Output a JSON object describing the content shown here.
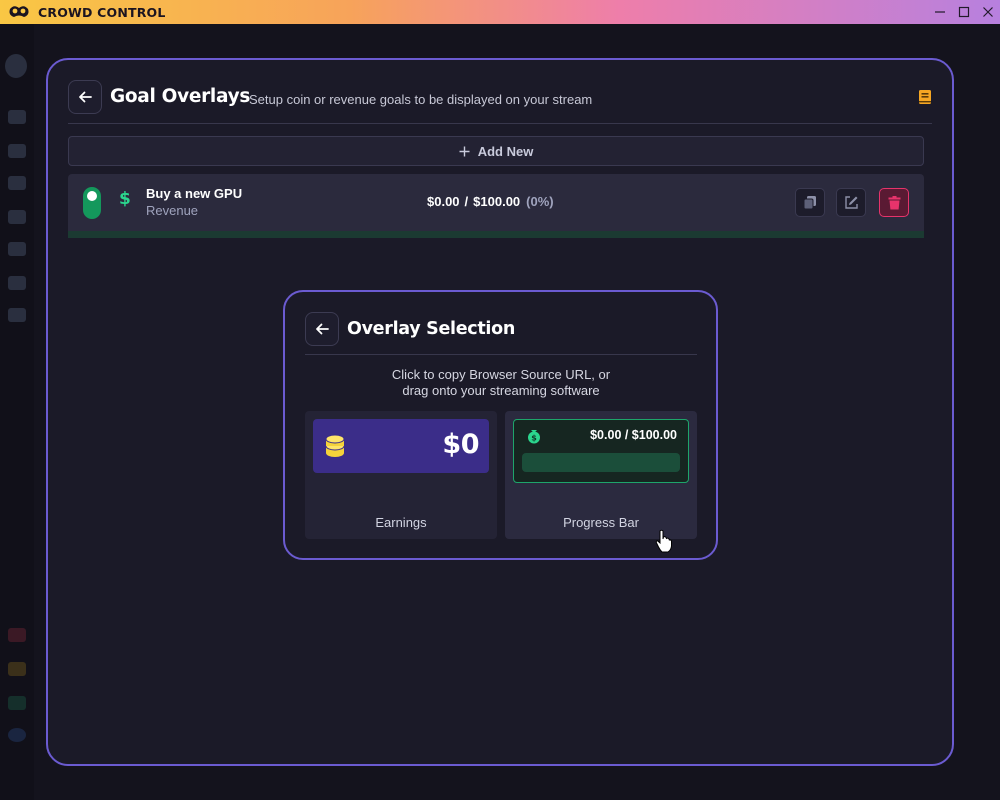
{
  "app": {
    "title": "CROWD CONTROL"
  },
  "window_controls": {
    "minimize": "—",
    "maximize": "☐",
    "close": "✕"
  },
  "page": {
    "title": "Goal Overlays",
    "subtitle": "Setup coin or revenue goals to be displayed on your stream",
    "add_new_label": "Add New"
  },
  "goals": [
    {
      "name": "Buy a new GPU",
      "type": "Revenue",
      "current": "$0.00",
      "separator": "/",
      "target": "$100.00",
      "percent": "(0%)",
      "progress_fraction": 0,
      "enabled": true
    }
  ],
  "overlay_selection": {
    "title": "Overlay Selection",
    "description_line1": "Click to copy Browser Source URL, or",
    "description_line2": "drag onto your streaming software",
    "options": [
      {
        "label": "Earnings",
        "preview_value": "$0"
      },
      {
        "label": "Progress Bar",
        "preview_value": "$0.00 / $100.00",
        "progress_fraction": 0
      }
    ]
  },
  "colors": {
    "accent": "#6b5bd1",
    "success": "#1f9e67",
    "danger": "#e6336b",
    "coin": "#f5d33a",
    "earnings_bg": "#3b2d89"
  },
  "icons": {
    "back": "arrow-left-icon",
    "doc": "book-icon",
    "copy": "copy-icon",
    "edit": "edit-icon",
    "delete": "trash-icon"
  }
}
